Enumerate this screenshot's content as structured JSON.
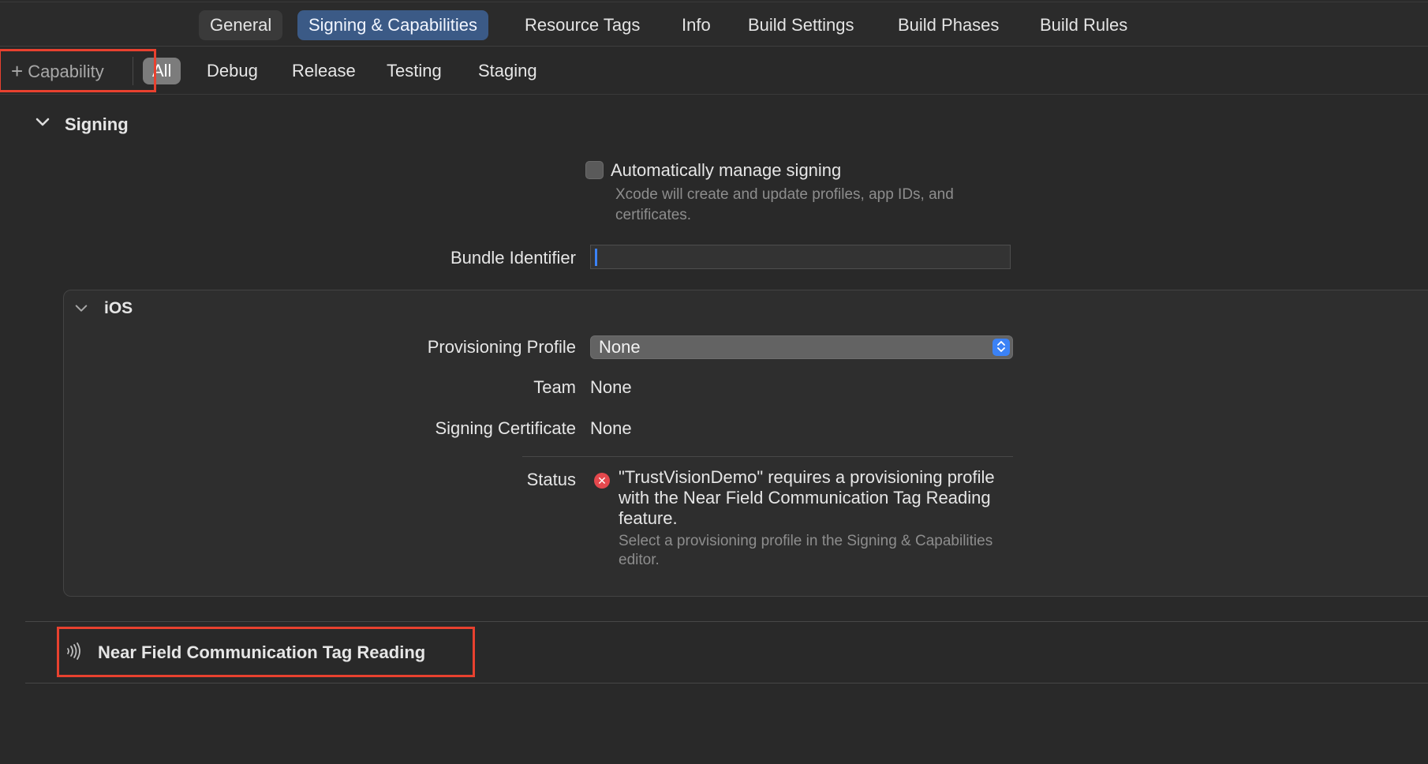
{
  "tabs": {
    "general": "General",
    "signing": "Signing & Capabilities",
    "resource_tags": "Resource Tags",
    "info": "Info",
    "build_settings": "Build Settings",
    "build_phases": "Build Phases",
    "build_rules": "Build Rules"
  },
  "toolbar": {
    "capability_plus": "+",
    "capability_label": "Capability",
    "filters": {
      "all": "All",
      "debug": "Debug",
      "release": "Release",
      "testing": "Testing",
      "staging": "Staging"
    }
  },
  "signing": {
    "title": "Signing",
    "auto_manage_label": "Automatically manage signing",
    "auto_manage_help": "Xcode will create and update profiles, app IDs, and certificates.",
    "bundle_id_label": "Bundle Identifier",
    "bundle_id_value": ""
  },
  "ios": {
    "title": "iOS",
    "provisioning_label": "Provisioning Profile",
    "provisioning_value": "None",
    "team_label": "Team",
    "team_value": "None",
    "cert_label": "Signing Certificate",
    "cert_value": "None",
    "status_label": "Status",
    "status_message": "\"TrustVisionDemo\" requires a provisioning profile with the Near Field Communication Tag Reading feature.",
    "status_help": "Select a provisioning profile in the Signing & Capabilities editor."
  },
  "capability": {
    "title": "Near Field Communication Tag Reading"
  },
  "colors": {
    "accent": "#3b82f6",
    "active_tab": "#3b5a86",
    "error": "#e5484d",
    "highlight": "#e8412f"
  },
  "icons": {
    "section_chevron": "chevron-down-icon",
    "error": "error-icon",
    "nfc": "nfc-icon"
  }
}
